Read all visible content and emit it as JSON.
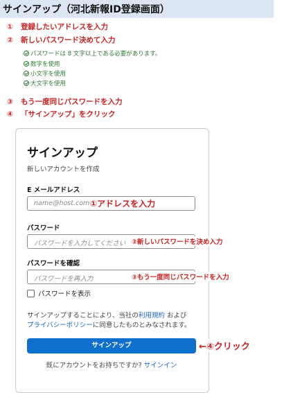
{
  "header": {
    "title": "サインアップ（河北新報ID登録画面）"
  },
  "steps": [
    {
      "num": "①",
      "text": "登録したいアドレスを入力"
    },
    {
      "num": "②",
      "text": "新しいパスワード決めて入力"
    },
    {
      "num": "③",
      "text": "もう一度同じパスワードを入力"
    },
    {
      "num": "④",
      "text": "「サインアップ」をクリック"
    }
  ],
  "requirements": [
    "パスワードは 8 文字以上である必要があります。",
    "数字を使用",
    "小文字を使用",
    "大文字を使用"
  ],
  "form": {
    "title": "サインアップ",
    "subtitle": "新しいアカウントを作成",
    "email_label": "E メールアドレス",
    "email_placeholder": "name@host.com",
    "password_label": "パスワード",
    "password_placeholder": "パスワードを入力してください",
    "confirm_label": "パスワードを確認",
    "confirm_placeholder": "パスワードを再入力",
    "show_password_label": "パスワードを表示",
    "terms_pre": "サインアップすることにより、当社の",
    "terms_link": "利用規約",
    "terms_and": "および",
    "privacy_link": "プライバシーポリシー",
    "terms_post": "に同意したものとみなされます。",
    "submit_label": "サインアップ",
    "signin_prompt": "既にアカウントをお持ちですか?",
    "signin_link": "サインイン"
  },
  "annotations": {
    "email": "①アドレスを入力",
    "password": "②新しいパスワードを決め入力",
    "confirm": "③もう一度同じパスワードを入力",
    "submit": "←④クリック"
  },
  "colors": {
    "accent": "#0f6fcd",
    "annotation": "#cc1f1f",
    "requirement": "#2e7d32",
    "header_bg": "#dce6f2"
  }
}
